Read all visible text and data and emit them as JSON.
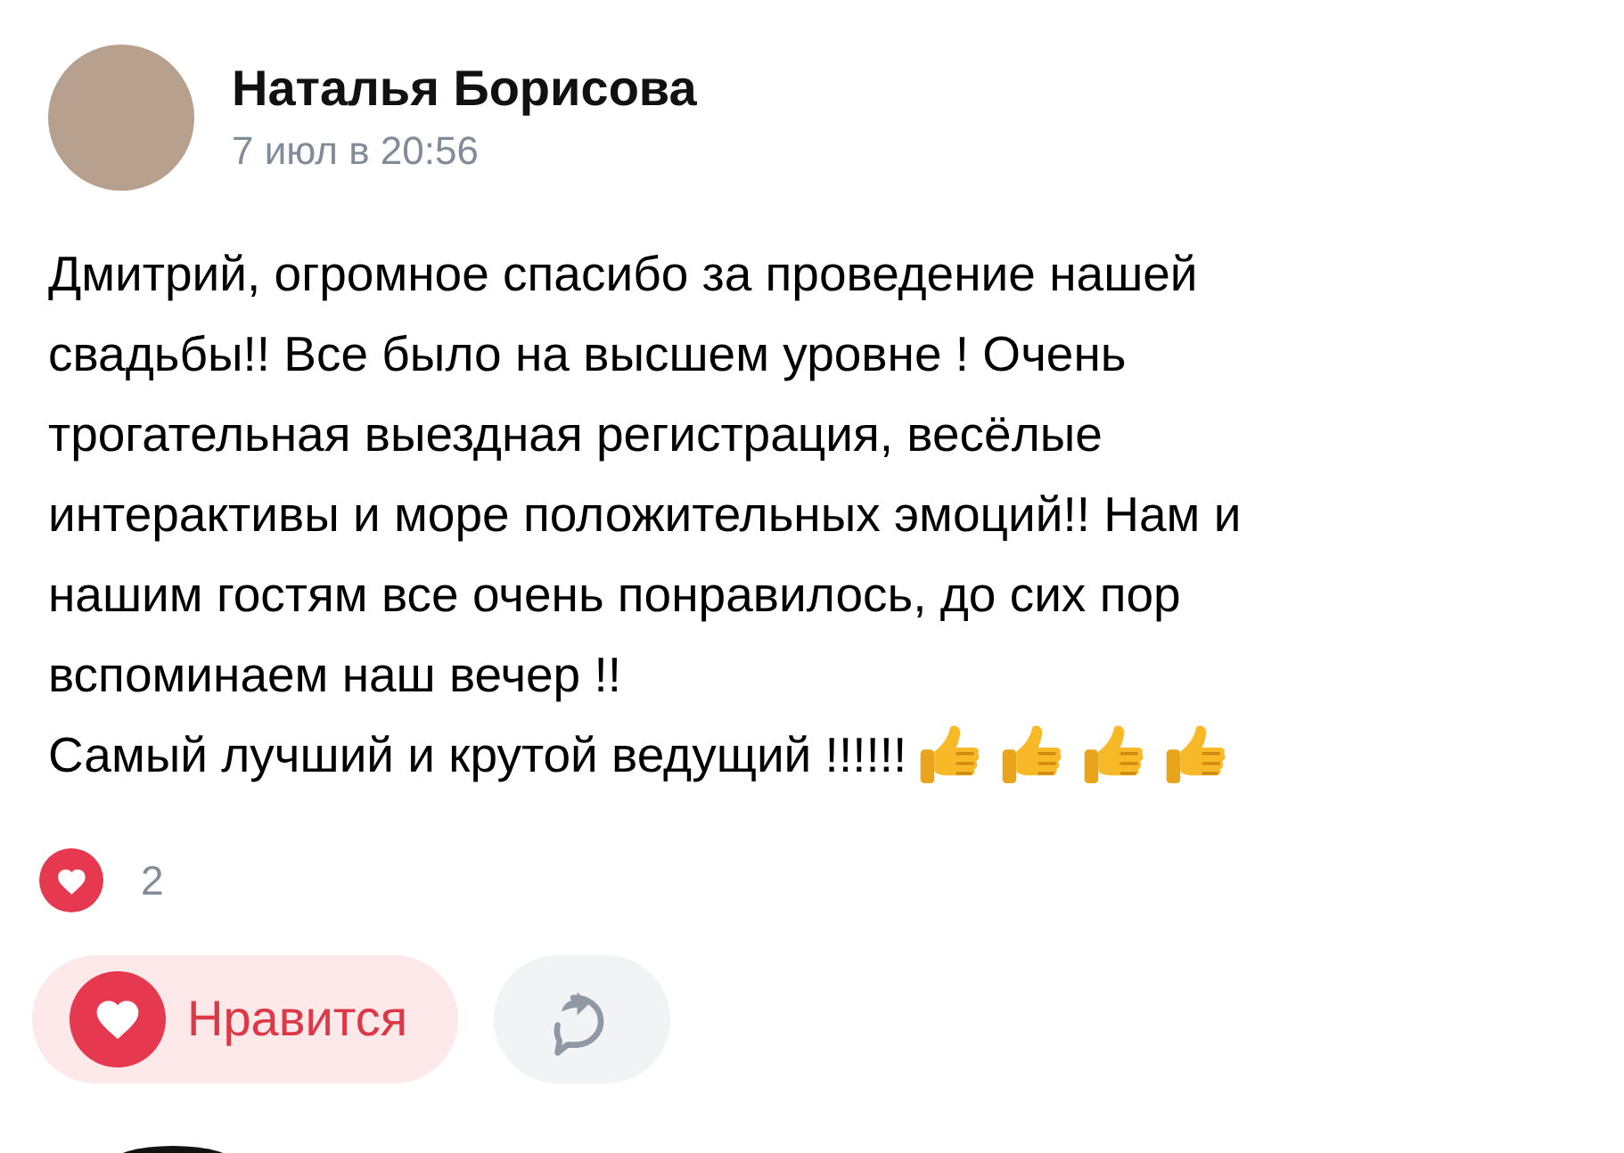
{
  "post": {
    "author": "Наталья Борисова",
    "date": "7 июл в 20:56",
    "text_lines": [
      "Дмитрий, огромное спасибо за проведение нашей",
      "свадьбы!! Все было на высшем уровне ! Очень",
      "трогательная выездная регистрация, весёлые",
      "интерактивы и море положительных эмоций!! Нам и",
      "нашим гостям все очень понравилось, до сих пор",
      "вспоминаем наш вечер !!",
      "Самый лучший и крутой ведущий !!!!!!"
    ],
    "likes_count": "2",
    "like_button": {
      "label": "Нравится",
      "selected": true
    }
  }
}
